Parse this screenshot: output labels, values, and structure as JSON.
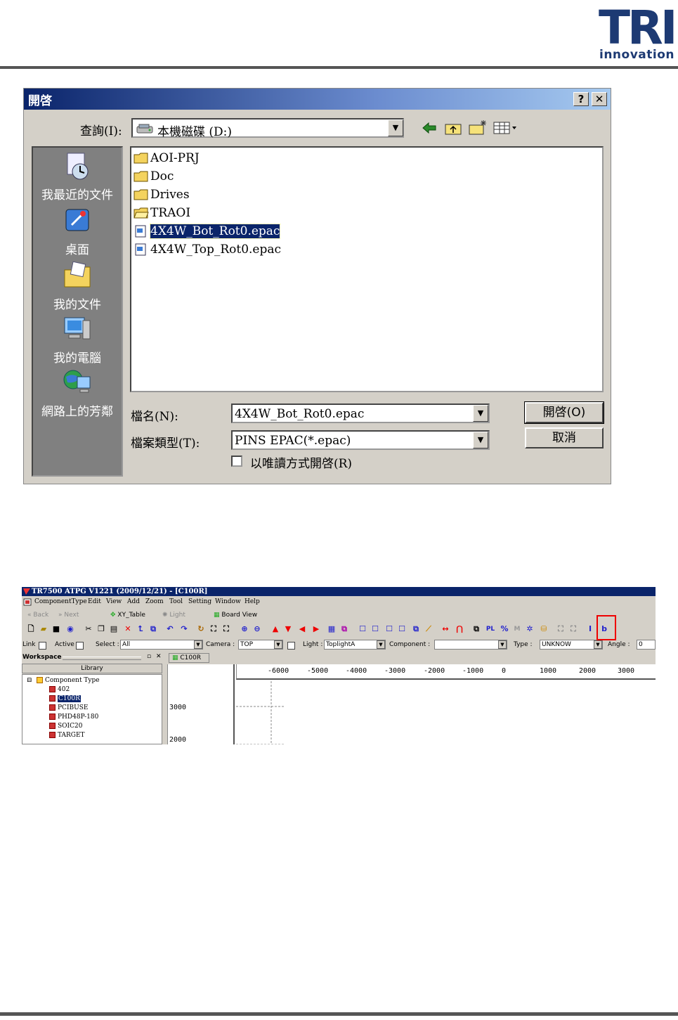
{
  "header": {
    "logo_text": "TRI",
    "logo_subtext": "innovation"
  },
  "open_dialog": {
    "title": "開啓",
    "help_label": "?",
    "close_label": "✕",
    "look_in_label": "查詢(I):",
    "look_in_value": "本機磁碟 (D:)",
    "places": [
      {
        "label": "我最近的文件",
        "icon": "recent-docs-icon"
      },
      {
        "label": "桌面",
        "icon": "desktop-icon"
      },
      {
        "label": "我的文件",
        "icon": "my-documents-icon"
      },
      {
        "label": "我的電腦",
        "icon": "my-computer-icon"
      },
      {
        "label": "網路上的芳鄰",
        "icon": "network-icon"
      }
    ],
    "files": [
      {
        "name": "AOI-PRJ",
        "kind": "folder"
      },
      {
        "name": "Doc",
        "kind": "folder"
      },
      {
        "name": "Drives",
        "kind": "folder"
      },
      {
        "name": "TRAOI",
        "kind": "folder"
      },
      {
        "name": "4X4W_Bot_Rot0.epac",
        "kind": "file",
        "selected": true
      },
      {
        "name": "4X4W_Top_Rot0.epac",
        "kind": "file"
      }
    ],
    "filename_label": "檔名(N):",
    "filename_value": "4X4W_Bot_Rot0.epac",
    "filetype_label": "檔案類型(T):",
    "filetype_value": "PINS EPAC(*.epac)",
    "readonly_label": "以唯讀方式開啓(R)",
    "open_button": "開啓(O)",
    "cancel_button": "取消"
  },
  "app": {
    "title": "TR7500 ATPG V1221 (2009/12/21) - [C100R]",
    "menus": [
      "ComponentType",
      "Edit",
      "View",
      "Add",
      "Zoom",
      "Tool",
      "Setting",
      "Window",
      "Help"
    ],
    "nav": {
      "back": "Back",
      "next": "Next",
      "xy_table": "XY_Table",
      "light": "Light",
      "board_view": "Board View"
    },
    "toolbar3": {
      "link": "Link",
      "active": "Active",
      "select_label": "Select :",
      "select_value": "All",
      "camera_label": "Camera :",
      "camera_value": "TOP",
      "light_label": "Light :",
      "light_value": "ToplightA",
      "component_label": "Component :",
      "component_value": "",
      "type_label": "Type :",
      "type_value": "UNKNOW",
      "angle_label": "Angle :",
      "angle_value": "0"
    },
    "workspace": {
      "title": "Workspace",
      "library_tab": "Library",
      "tree_root": "Component Type",
      "tree_items": [
        "402",
        "C100R",
        "PCIBUSE",
        "PHD48P-180",
        "SOIC20",
        "TARGET"
      ],
      "selected_item": "C100R"
    },
    "view_tab": "C100R",
    "x_ticks": [
      "-6000",
      "-5000",
      "-4000",
      "-3000",
      "-2000",
      "-1000",
      "0",
      "1000",
      "2000",
      "3000"
    ],
    "y_ticks": [
      "3000",
      "2000"
    ],
    "highlight_color": "#e00000"
  }
}
